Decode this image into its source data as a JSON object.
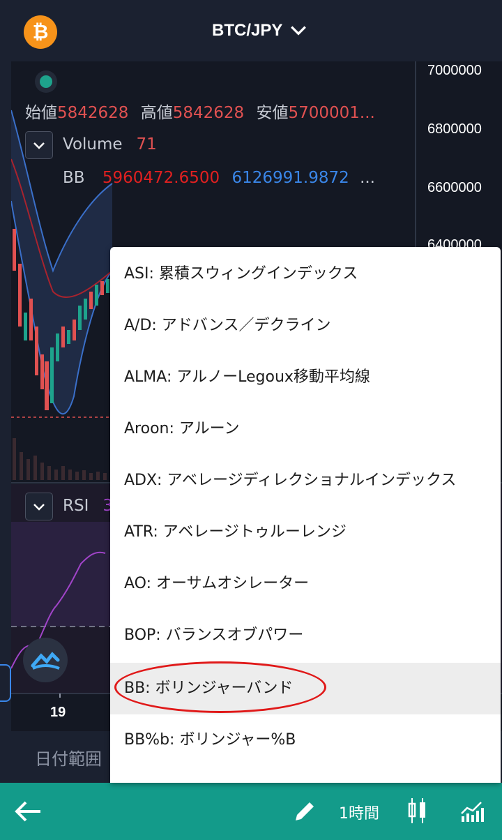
{
  "header": {
    "coin_symbol": "₿",
    "pair": "BTC/JPY",
    "coin_color": "#f7931a"
  },
  "price_axis": [
    "7000000",
    "6800000",
    "6600000",
    "6400000"
  ],
  "legend": {
    "ohlc_open_label": "始値",
    "ohlc_open_value": "5842628",
    "ohlc_high_label": "高値",
    "ohlc_high_value": "5842628",
    "ohlc_low_label": "安値",
    "ohlc_low_value": "5700001...",
    "volume_label": "Volume",
    "volume_value": "71",
    "bb_label": "BB",
    "bb_value_1": "5960472.6500",
    "bb_value_2": "6126991.9872",
    "bb_more": "...",
    "rsi_label": "RSI",
    "rsi_value_partial": "3"
  },
  "time_axis": [
    "19"
  ],
  "date_range_label": "日付範囲",
  "toolbar": {
    "timeframe": "1時間",
    "accent": "#139b8a"
  },
  "indicators_menu": {
    "items": [
      "ASI: 累積スウィングインデックス",
      "A/D: アドバンス／デクライン",
      "ALMA: アルノーLegoux移動平均線",
      "Aroon: アルーン",
      "ADX: アベレージディレクショナルインデックス",
      "ATR: アベレージトゥルーレンジ",
      "AO: オーサムオシレーター",
      "BOP: バランスオブパワー",
      "BB: ボリンジャーバンド",
      "BB%b: ボリンジャー%B"
    ],
    "selected_index": 8
  }
}
